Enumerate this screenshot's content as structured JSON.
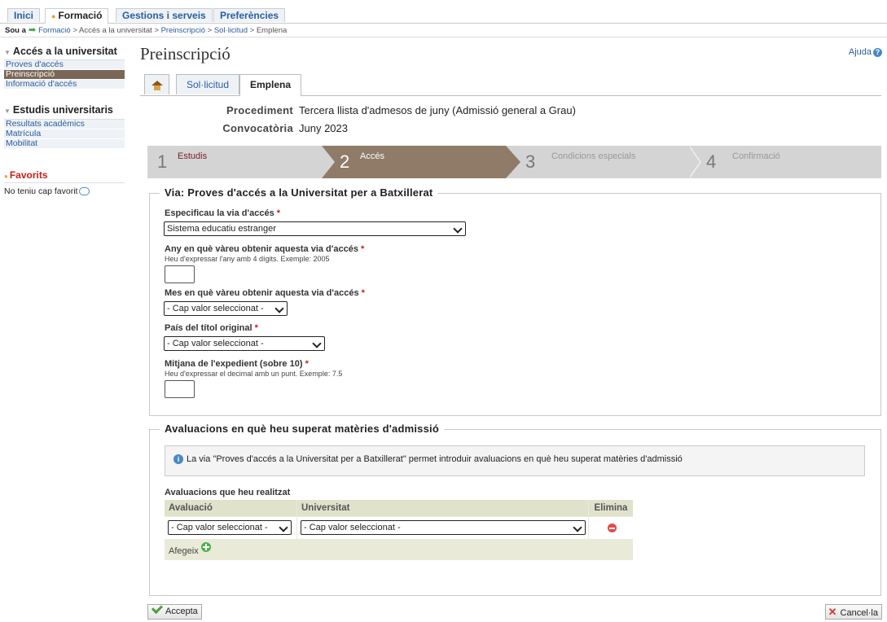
{
  "top_tabs": [
    "Inici",
    "Formació",
    "Gestions i serveis",
    "Preferències"
  ],
  "breadcrumb": {
    "prefix": "Sou a",
    "items": [
      "Formació",
      "Accés a la universitat",
      "Preinscripció",
      "Sol·licitud",
      "Emplena"
    ]
  },
  "sidebar": {
    "section1": {
      "title": "Accés a la universitat",
      "items": [
        "Proves d'accés",
        "Preinscripció",
        "Informació d'accés"
      ]
    },
    "section2": {
      "title": "Estudis universitaris",
      "items": [
        "Resultats acadèmics",
        "Matrícula",
        "Mobilitat"
      ]
    },
    "favorites": {
      "title": "Favorits",
      "empty_text": "No teniu cap favorit"
    }
  },
  "page": {
    "title": "Preinscripció",
    "help": "Ajuda"
  },
  "subtabs": {
    "tab1": "Sol·licitud",
    "tab2": "Emplena"
  },
  "info": {
    "procedure_label": "Procediment",
    "procedure_value": "Tercera llista d'admesos de juny (Admissió general a Grau)",
    "call_label": "Convocatòria",
    "call_value": "Juny 2023"
  },
  "steps": [
    {
      "num": "1",
      "label": "Estudis"
    },
    {
      "num": "2",
      "label": "Accés"
    },
    {
      "num": "3",
      "label": "Condicions especials"
    },
    {
      "num": "4",
      "label": "Confirmació"
    }
  ],
  "via": {
    "legend": "Via: Proves d'accés a la Universitat per a Batxillerat",
    "f1_label": "Especificau la via d'accés",
    "f1_value": "Sistema educatiu estranger",
    "f2_label": "Any en què vàreu obtenir aquesta via d'accés",
    "f2_hint": "Heu d'expressar l'any amb 4 dígits. Exemple: 2005",
    "f3_label": "Mes en què vàreu obtenir aquesta via d'accés",
    "f3_value": "- Cap valor seleccionat -",
    "f4_label": "País del títol original",
    "f4_value": "- Cap valor seleccionat -",
    "f5_label": "Mitjana de l'expedient (sobre 10)",
    "f5_hint": "Heu d'expressar el decimal amb un punt. Exemple: 7.5",
    "required_mark": "*"
  },
  "evals": {
    "legend": "Avaluacions en què heu superat matèries d'admissió",
    "info": "La via \"Proves d'accés a la Universitat per a Batxillerat\" permet introduir avaluacions en què heu superat matèries d'admissió",
    "table_title": "Avaluacions que heu realitzat",
    "col_eval": "Avaluació",
    "col_univ": "Universitat",
    "col_del": "Elimina",
    "row_eval": "- Cap valor seleccionat -",
    "row_univ": "- Cap valor seleccionat -",
    "add": "Afegeix"
  },
  "buttons": {
    "accept": "Accepta",
    "cancel": "Cancel·la"
  },
  "colors": {
    "accent_brown": "#8f7b67",
    "link_blue": "#2a5d9f",
    "required_red": "#c8201a"
  }
}
